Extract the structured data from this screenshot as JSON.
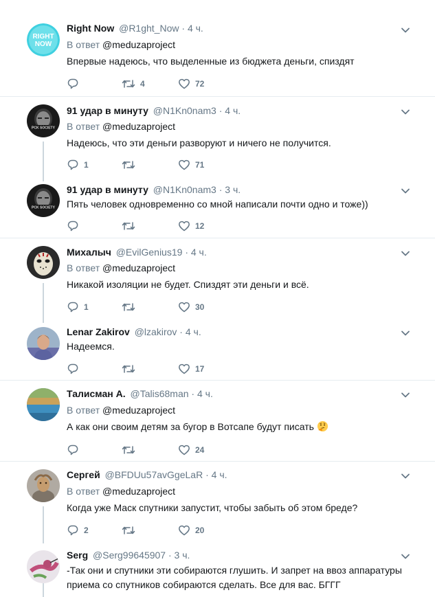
{
  "tweets": [
    {
      "name": "Right Now",
      "handle": "@R1ght_Now",
      "time": "4 ч.",
      "reply_prefix": "В ответ",
      "reply_to": "@meduzaproject",
      "text": "Впервые надеюсь, что выделенные из бюджета деньги, спиздят",
      "replies": "",
      "retweets": "4",
      "likes": "72",
      "avatar_text": "RIGHT NOW"
    },
    {
      "name": "91 удар в минуту",
      "handle": "@N1Kn0nam3",
      "time": "4 ч.",
      "reply_prefix": "В ответ",
      "reply_to": "@meduzaproject",
      "text": "Надеюсь, что эти деньги разворуют и ничего не получится.",
      "replies": "1",
      "retweets": "",
      "likes": "71",
      "avatar_text": "PCK SOCIETY"
    },
    {
      "name": "91 удар в минуту",
      "handle": "@N1Kn0nam3",
      "time": "3 ч.",
      "text": "Пять человек одновременно со мной написали почти одно и тоже))",
      "replies": "",
      "retweets": "",
      "likes": "12",
      "avatar_text": "PCK SOCIETY"
    },
    {
      "name": "Михалыч",
      "handle": "@EvilGenius19",
      "time": "4 ч.",
      "reply_prefix": "В ответ",
      "reply_to": "@meduzaproject",
      "text": "Никакой изоляции не будет. Спиздят эти деньги и всё.",
      "replies": "1",
      "retweets": "",
      "likes": "30"
    },
    {
      "name": "Lenar Zakirov",
      "handle": "@lzakirov",
      "time": "4 ч.",
      "text": "Надеемся.",
      "replies": "",
      "retweets": "",
      "likes": "17"
    },
    {
      "name": "Талисман А.",
      "handle": "@Talis68man",
      "time": "4 ч.",
      "reply_prefix": "В ответ",
      "reply_to": "@meduzaproject",
      "text": "А как они своим детям за бугор в Вотсапе будут писать",
      "replies": "",
      "retweets": "",
      "likes": "24"
    },
    {
      "name": "Сергей",
      "handle": "@BFDUu57avGgeLaR",
      "time": "4 ч.",
      "reply_prefix": "В ответ",
      "reply_to": "@meduzaproject",
      "text": "Когда уже Маск спутники запустит, чтобы забыть об этом бреде?",
      "replies": "2",
      "retweets": "",
      "likes": "20"
    },
    {
      "name": "Serg",
      "handle": "@Serg99645907",
      "time": "3 ч.",
      "text_line1": "-Так они и спутники эти собираются глушить. И запрет на ввоз аппаратуры",
      "text_line2": "приема со спутников собираются сделать. Все для вас. БГГГ"
    }
  ],
  "colors": {
    "secondary_text": "#657786",
    "primary_text": "#14171a",
    "separator": "#e6ecf0",
    "thread_line": "#ccd6dd",
    "brand_avatar": "#3fd0e0"
  },
  "icons": [
    "reply-icon",
    "retweet-icon",
    "like-icon",
    "caret-down-icon",
    "thinking-face-emoji"
  ]
}
